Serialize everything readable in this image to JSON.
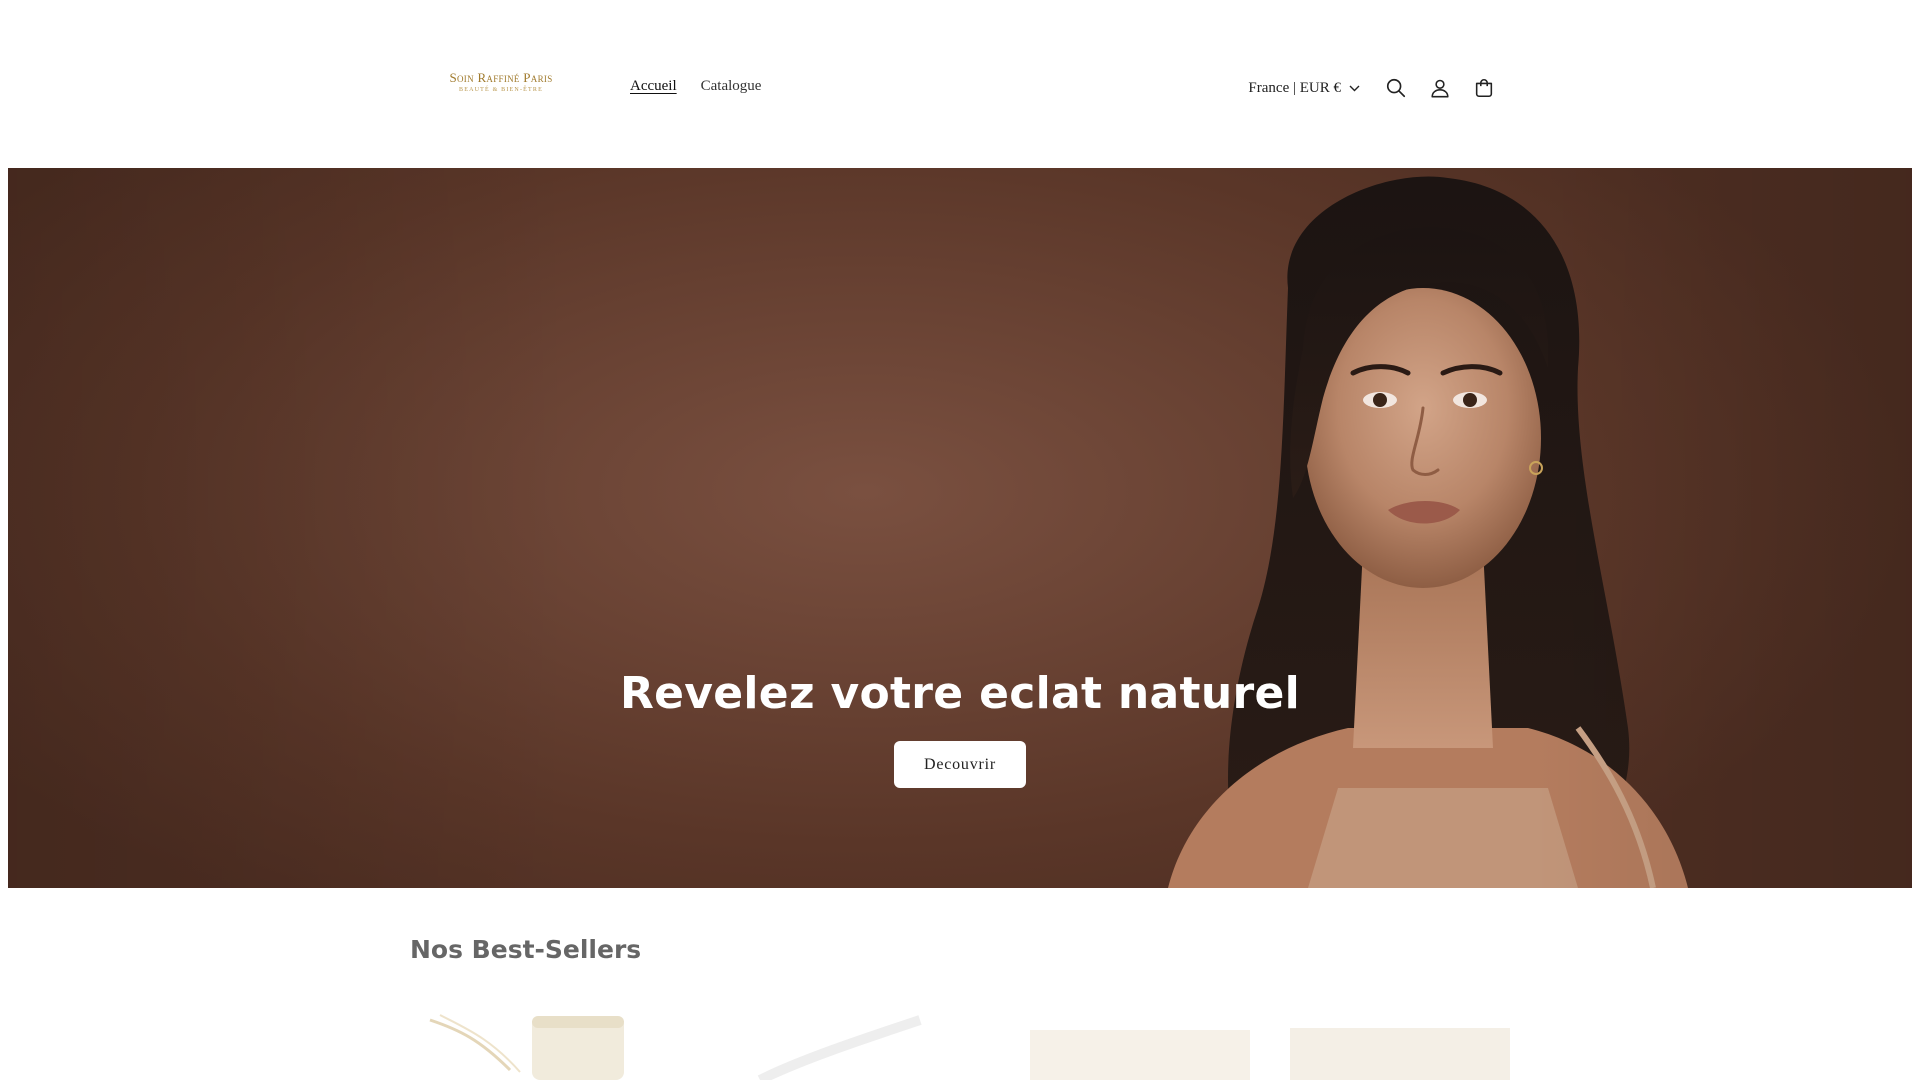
{
  "brand": {
    "name": "Soin Raffiné Paris",
    "tagline": "BEAUTÉ & BIEN-ÊTRE"
  },
  "nav": {
    "items": [
      {
        "label": "Accueil",
        "active": true
      },
      {
        "label": "Catalogue",
        "active": false
      }
    ]
  },
  "header": {
    "locale_label": "France | EUR €",
    "icons": [
      "search-icon",
      "account-icon",
      "cart-icon"
    ]
  },
  "hero": {
    "title": "Revelez votre eclat naturel",
    "cta_label": "Decouvrir",
    "background_color": "#6a4334"
  },
  "bestsellers": {
    "title": "Nos Best-Sellers"
  },
  "colors": {
    "brand_gold": "#a07a2c",
    "text_dark": "#222222",
    "section_title": "#666666"
  }
}
